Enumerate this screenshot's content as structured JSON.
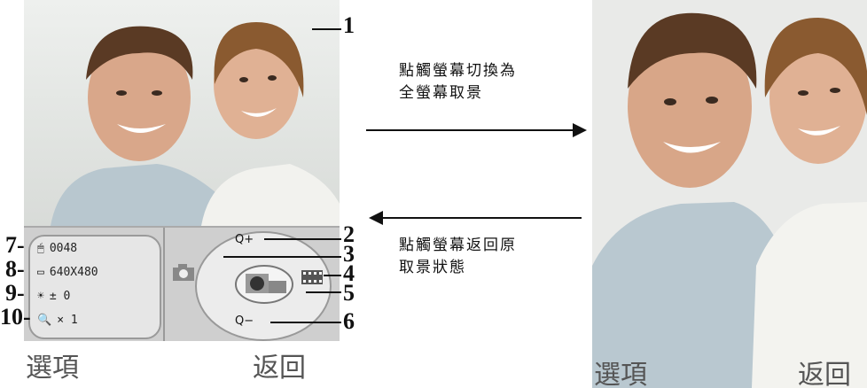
{
  "left_screen": {
    "info_rows": [
      {
        "icon": "shot-count-icon",
        "text": "0048"
      },
      {
        "icon": "resolution-icon",
        "text": "640X480"
      },
      {
        "icon": "brightness-icon",
        "text": "± 0"
      },
      {
        "icon": "zoom-icon",
        "text": "× 1"
      }
    ],
    "zoom_in_label": "Q+",
    "zoom_out_label": "Q−",
    "softkey_left": "選項",
    "softkey_right": "返回"
  },
  "callout_numbers": [
    "1",
    "2",
    "3",
    "4",
    "5",
    "6",
    "7-",
    "8-",
    "9-",
    "10-"
  ],
  "arrows": {
    "forward_caption_line1": "點觸螢幕切換為",
    "forward_caption_line2": "全螢幕取景",
    "back_caption_line1": "點觸螢幕返回原",
    "back_caption_line2": "取景狀態"
  },
  "right_screen": {
    "softkey_left": "選項",
    "softkey_right": "返回"
  }
}
